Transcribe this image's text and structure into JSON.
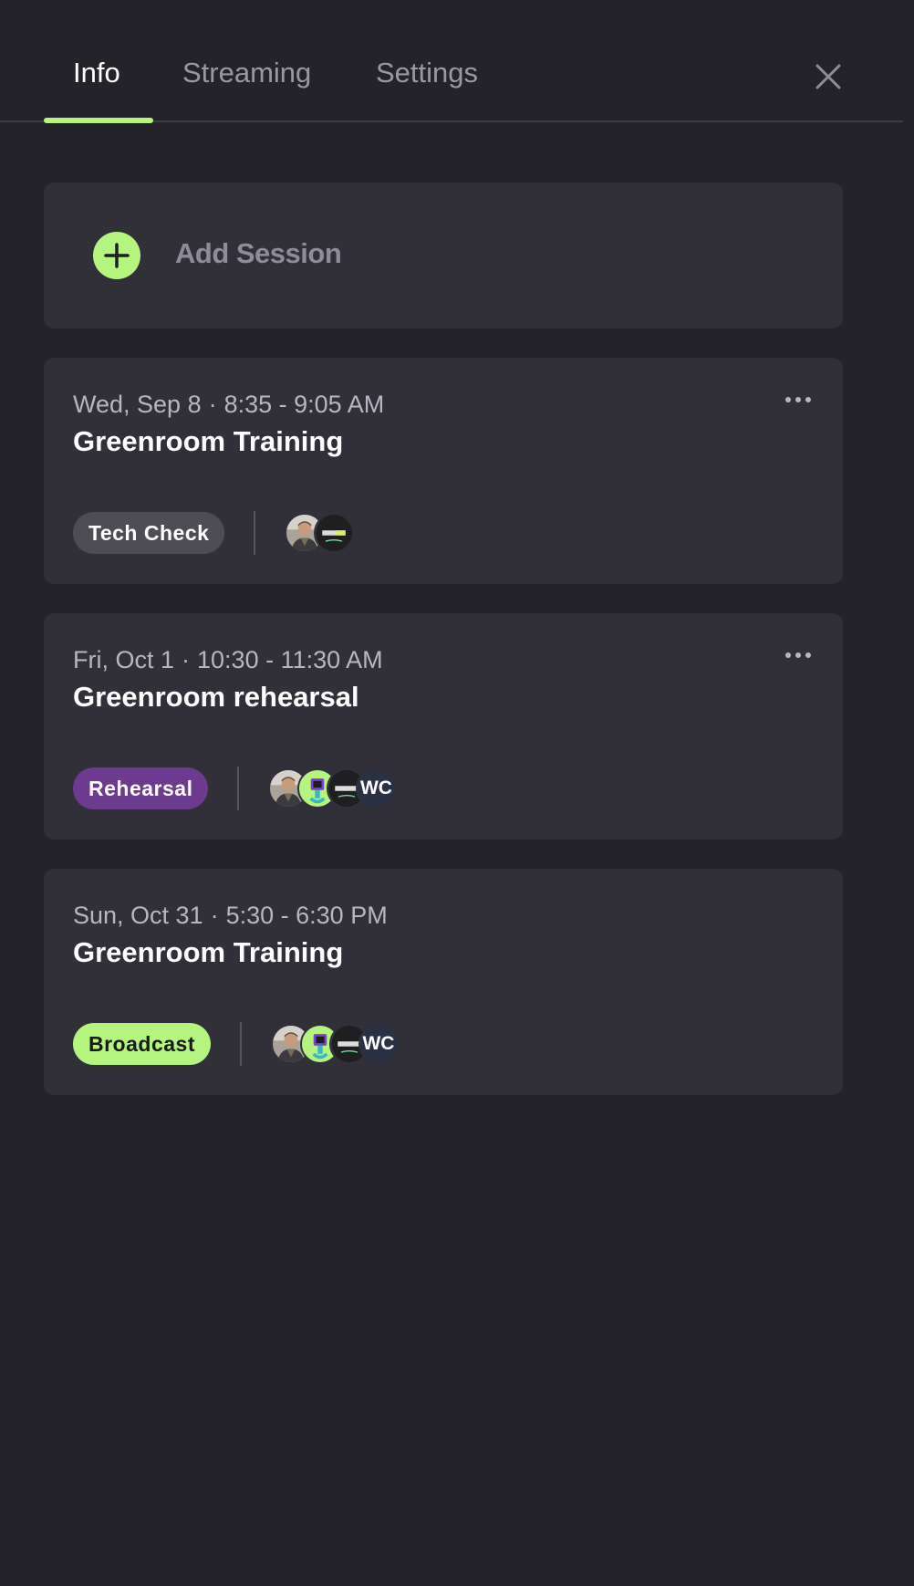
{
  "tabs": [
    {
      "label": "Info",
      "active": true
    },
    {
      "label": "Streaming",
      "active": false
    },
    {
      "label": "Settings",
      "active": false
    }
  ],
  "accent_color": "#b5f57f",
  "add_session": {
    "label": "Add Session",
    "icon": "plus-circle-icon"
  },
  "sessions": [
    {
      "date": "Wed, Sep 8",
      "time": "8:35 - 9:05 AM",
      "title": "Greenroom Training",
      "type": "Tech Check",
      "type_color": "#4e4d56",
      "has_menu": true,
      "participants": [
        {
          "kind": "photo",
          "icon": "person-avatar"
        },
        {
          "kind": "logo",
          "icon": "brandlive-logo-avatar"
        }
      ]
    },
    {
      "date": "Fri, Oct 1",
      "time": "10:30 - 11:30 AM",
      "title": "Greenroom rehearsal",
      "type": "Rehearsal",
      "type_color": "#6c3a8f",
      "has_menu": true,
      "participants": [
        {
          "kind": "photo",
          "icon": "person-avatar"
        },
        {
          "kind": "character",
          "icon": "character-avatar"
        },
        {
          "kind": "logo",
          "icon": "brandlive-logo-avatar"
        },
        {
          "kind": "initials",
          "text": "WC"
        }
      ]
    },
    {
      "date": "Sun, Oct 31",
      "time": "5:30 - 6:30 PM",
      "title": "Greenroom Training",
      "type": "Broadcast",
      "type_color": "#b5f57f",
      "has_menu": false,
      "participants": [
        {
          "kind": "photo",
          "icon": "person-avatar"
        },
        {
          "kind": "character",
          "icon": "character-avatar"
        },
        {
          "kind": "logo",
          "icon": "brandlive-logo-avatar"
        },
        {
          "kind": "initials",
          "text": "WC"
        }
      ]
    }
  ]
}
